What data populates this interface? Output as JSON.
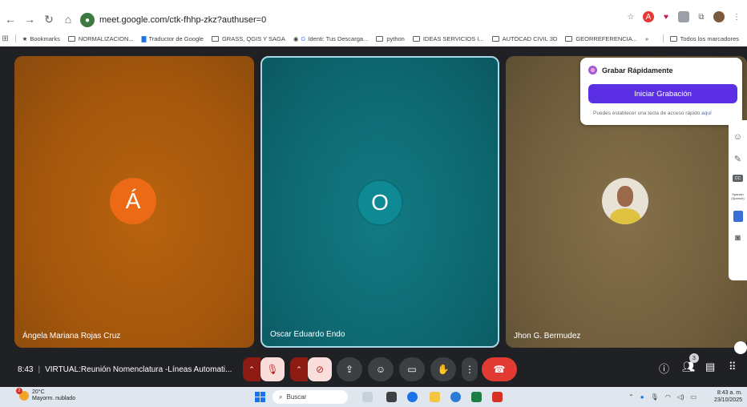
{
  "browser": {
    "url": "meet.google.com/ctk-fhhp-zkz?authuser=0",
    "bookmarks": [
      "Bookmarks",
      "NORMALIZACION...",
      "Traductor de Google",
      "GRASS, QGIS Y SAGA",
      "Identi: Tus Descarga...",
      "python",
      "IDEAS SERVICIOS I...",
      "AUTOCAD CIVIL 3D",
      "GEORREFERENCIA...",
      "Todos los marcadores"
    ],
    "more_bookmarks": "»"
  },
  "participants": [
    {
      "name": "Ángela Mariana Rojas Cruz",
      "initial": "Á"
    },
    {
      "name": "Oscar Eduardo Endo",
      "initial": "O"
    },
    {
      "name": "Jhon G. Bermudez",
      "initial": ""
    }
  ],
  "recording_popup": {
    "title": "Grabar Rápidamente",
    "button": "Iniciar Grabación",
    "hint": "Puedes establecer una tecla de acceso rápido",
    "hint_link": "aquí"
  },
  "side_panel": {
    "cc_label": "CC",
    "lang_label": "Spanish (Speech)"
  },
  "meeting": {
    "time": "8:43",
    "title": "VIRTUAL:Reunión Nomenclatura -Líneas Automati...",
    "people_count": "3"
  },
  "taskbar": {
    "temperature": "20°C",
    "weather": "Mayorm. nublado",
    "weather_badge": "2",
    "search_placeholder": "Buscar",
    "time": "8:43 a. m.",
    "date": "23/10/2025"
  },
  "colors": {
    "tile1": "#a3560c",
    "tile2": "#0e6a73",
    "tile3": "#725f3d",
    "accent": "#5b2fe3",
    "end_call": "#e23b33"
  }
}
